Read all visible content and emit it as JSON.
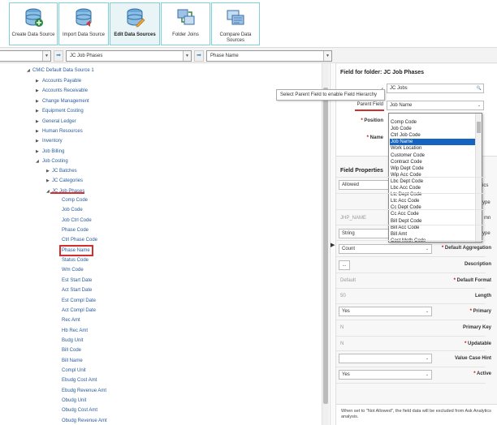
{
  "toolbar": {
    "buttons": [
      {
        "label": "Create Data Source",
        "icon": "database-add-icon"
      },
      {
        "label": "Import Data Source",
        "icon": "database-import-icon"
      },
      {
        "label": "Edit Data Sources",
        "icon": "database-edit-icon"
      },
      {
        "label": "Folder Joins",
        "icon": "folder-joins-icon"
      },
      {
        "label": "Compare Data Sources",
        "icon": "compare-icon"
      }
    ]
  },
  "pathbar": {
    "folder_value": "JC Job Phases",
    "field_value": "Phase Name"
  },
  "tree": {
    "root": "CMiC Default Data Source 1",
    "folders": [
      "Accounts Payable",
      "Accounts Receivable",
      "Change Management",
      "Equipment Costing",
      "General Ledger",
      "Human Resources",
      "Inventory",
      "Job Billing",
      "Job Costing"
    ],
    "job_costing_children": [
      "JC Batches",
      "JC Categories",
      "JC Job Phases"
    ],
    "fields": [
      "Comp Code",
      "Job Code",
      "Job Ctrl Code",
      "Phase Code",
      "Ctrl Phase Code",
      "Phase Name",
      "Status Code",
      "Wm Code",
      "Est Start Date",
      "Act Start Date",
      "Est Compl Date",
      "Act Compl Date",
      "Rec Amt",
      "Hb Rec Amt",
      "Budg Unit",
      "Bill Code",
      "Bill Name",
      "Compl Unit",
      "Ebudg Cost Amt",
      "Ebudg Revenue Amt",
      "Obudg Unit",
      "Obudg Cost Amt",
      "Obudg Revenue Amt"
    ]
  },
  "right": {
    "title": "Field for folder: JC Job Phases",
    "folder_value": "JC Jobs",
    "parent_field_label": "Parent Field",
    "parent_field_value": "Job Name",
    "position_label": "Position",
    "name_label": "Name",
    "tooltip": "Select Parent Field to enable Field Hierarchy",
    "props_title": "Field Properties",
    "allowed_value": "Allowed",
    "col_name": "JHP_NAME",
    "datatype_value": "String",
    "aggregation_value": "Count",
    "aggregation_label": "Default Aggregation",
    "description_label": "Description",
    "ellipsis": "...",
    "format_value": "Default",
    "format_label": "Default Format",
    "length_value": "50",
    "length_label": "Length",
    "primary_value": "Yes",
    "primary_label": "Primary",
    "primary_key_value": "N",
    "primary_key_label": "Primary Key",
    "updatable_value": "N",
    "updatable_label": "Updatable",
    "value_case_label": "Value Case Hint",
    "active_value": "Yes",
    "active_label": "Active",
    "partial_labels": [
      "r",
      "ics",
      "ype",
      "mn",
      "ype"
    ],
    "footer": "When set to \"Not Allowed\", the field data will be excluded from Ask Analytics analysis."
  },
  "listbox": {
    "items": [
      "Comp Code",
      "Job Code",
      "Ctrl Job Code",
      "Job Name",
      "Work Location",
      "Customer Code",
      "Contract Code",
      "Wip Dept Code",
      "Wip Acc Code",
      "Lbc Dept Code",
      "Lbc Acc Code",
      "Ltc Dept Code",
      "Ltc Acc Code",
      "Cc Dept Code",
      "Cc Acc Code",
      "Bill Dept Code",
      "Bill Acc Code",
      "Bill Amt",
      "Cost Meth Code"
    ],
    "highlighted_index": 3
  }
}
